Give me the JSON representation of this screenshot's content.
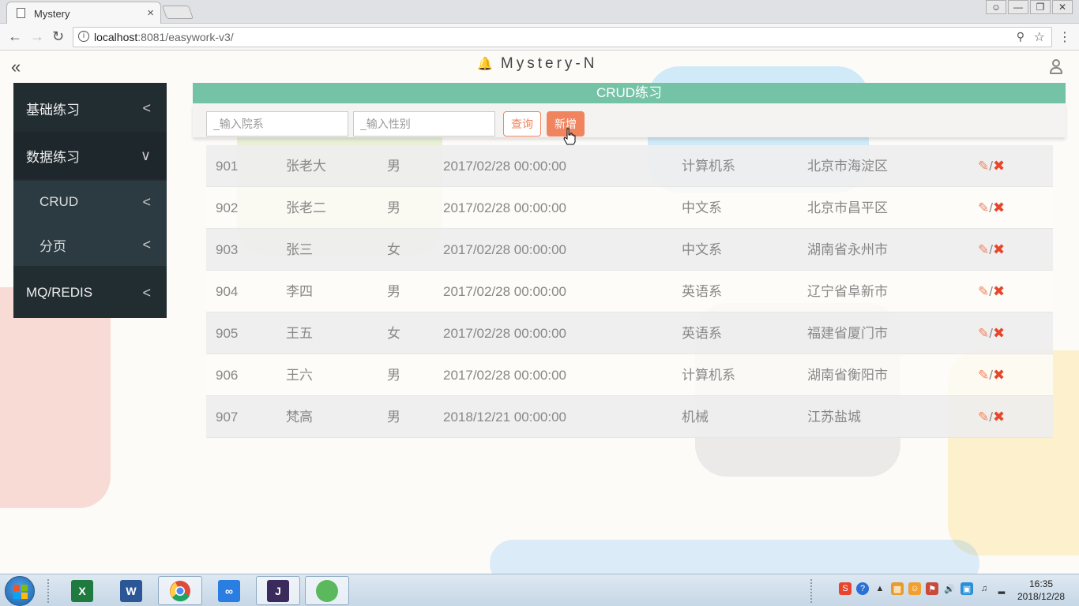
{
  "browser": {
    "tab_title": "Mystery",
    "tab_close": "×",
    "url_host": "localhost",
    "url_path": ":8081/easywork-v3/",
    "info_glyph": "i",
    "zoom_icon": "zoom-icon",
    "star_icon": "star-icon"
  },
  "header": {
    "collapse": "«",
    "brand": "Mystery-N"
  },
  "sidebar": {
    "items": [
      {
        "label": "基础练习",
        "chevron": "<"
      },
      {
        "label": "数据练习",
        "chevron": "∨"
      },
      {
        "label": "CRUD",
        "chevron": "<"
      },
      {
        "label": "分页",
        "chevron": "<"
      },
      {
        "label": "MQ/REDIS",
        "chevron": "<"
      }
    ]
  },
  "panel": {
    "title": "CRUD练习",
    "dept_placeholder": "_输入院系",
    "sex_placeholder": "_输入性别",
    "query_label": "查询",
    "add_label": "新增"
  },
  "table": {
    "rows": [
      {
        "id": "901",
        "name": "张老大",
        "sex": "男",
        "date": "2017/02/28 00:00:00",
        "dept": "计算机系",
        "addr": "北京市海淀区"
      },
      {
        "id": "902",
        "name": "张老二",
        "sex": "男",
        "date": "2017/02/28 00:00:00",
        "dept": "中文系",
        "addr": "北京市昌平区"
      },
      {
        "id": "903",
        "name": "张三",
        "sex": "女",
        "date": "2017/02/28 00:00:00",
        "dept": "中文系",
        "addr": "湖南省永州市"
      },
      {
        "id": "904",
        "name": "李四",
        "sex": "男",
        "date": "2017/02/28 00:00:00",
        "dept": "英语系",
        "addr": "辽宁省阜新市"
      },
      {
        "id": "905",
        "name": "王五",
        "sex": "女",
        "date": "2017/02/28 00:00:00",
        "dept": "英语系",
        "addr": "福建省厦门市"
      },
      {
        "id": "906",
        "name": "王六",
        "sex": "男",
        "date": "2017/02/28 00:00:00",
        "dept": "计算机系",
        "addr": "湖南省衡阳市"
      },
      {
        "id": "907",
        "name": "梵高",
        "sex": "男",
        "date": "2018/12/21 00:00:00",
        "dept": "机械",
        "addr": "江苏盐城"
      }
    ],
    "action_edit": "✎",
    "action_sep": "/",
    "action_delete": "✖"
  },
  "taskbar": {
    "apps": [
      {
        "name": "excel",
        "glyph": "X",
        "color": "#1f7a3f"
      },
      {
        "name": "word",
        "glyph": "W",
        "color": "#2b5797"
      },
      {
        "name": "chrome",
        "glyph": "",
        "color": "#dd4b39"
      },
      {
        "name": "baidu-netdisk",
        "glyph": "∞",
        "color": "#2a7de1"
      },
      {
        "name": "java-ee-ide",
        "glyph": "J",
        "color": "#3b2a5c"
      },
      {
        "name": "green-ball",
        "glyph": "",
        "color": "#5cb85c"
      }
    ],
    "time": "16:35",
    "date": "2018/12/28"
  },
  "colors": {
    "accent_green": "#75c3a7",
    "accent_orange": "#f0845f",
    "sidebar_bg": "#222d32",
    "delete_red": "#e8462b"
  }
}
